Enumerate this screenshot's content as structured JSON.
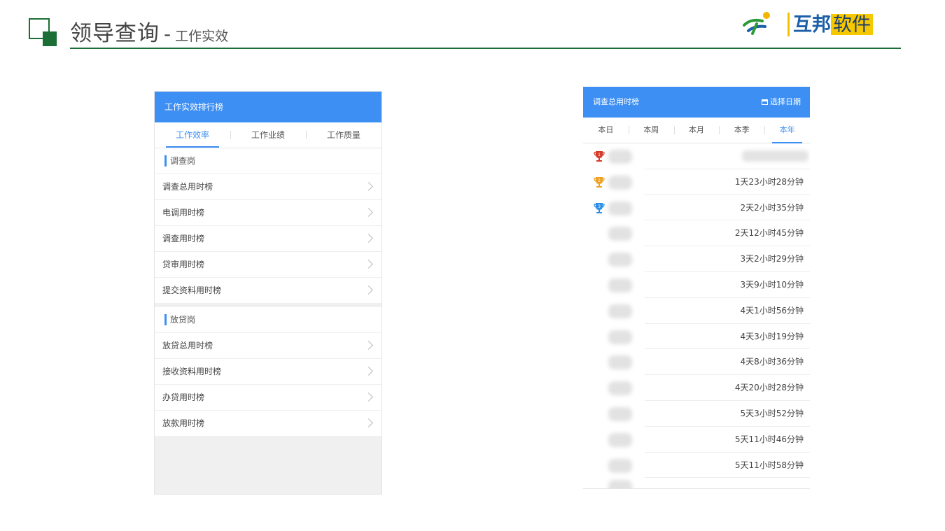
{
  "slide": {
    "title_main": "领导查询",
    "title_dash": "-",
    "title_sub": "工作实效",
    "accent_color": "#1b6e35"
  },
  "logo": {
    "icon": "running-figure-logo-icon",
    "text_part1": "互邦",
    "text_part2": "软件"
  },
  "left_panel": {
    "header_title": "工作实效排行榜",
    "tabs": [
      {
        "label": "工作效率",
        "active": true
      },
      {
        "label": "工作业绩",
        "active": false
      },
      {
        "label": "工作质量",
        "active": false
      }
    ],
    "sections": [
      {
        "title": "调查岗",
        "items": [
          "调查总用时榜",
          "电调用时榜",
          "调查用时榜",
          "贷审用时榜",
          "提交资料用时榜"
        ]
      },
      {
        "title": "放贷岗",
        "items": [
          "放贷总用时榜",
          "接收资料用时榜",
          "办贷用时榜",
          "放款用时榜"
        ]
      }
    ]
  },
  "right_panel": {
    "header_title": "调查总用时榜",
    "date_picker_label": "选择日期",
    "date_picker_icon": "calendar-icon",
    "tabs": [
      {
        "label": "本日",
        "active": false
      },
      {
        "label": "本周",
        "active": false
      },
      {
        "label": "本月",
        "active": false
      },
      {
        "label": "本季",
        "active": false
      },
      {
        "label": "本年",
        "active": true
      }
    ],
    "rows": [
      {
        "rank_icon": "trophy-gold-1-icon",
        "time": ""
      },
      {
        "rank_icon": "trophy-silver-2-icon",
        "time": "1天23小时28分钟"
      },
      {
        "rank_icon": "trophy-bronze-3-icon",
        "time": "2天2小时35分钟"
      },
      {
        "rank_icon": "",
        "time": "2天12小时45分钟"
      },
      {
        "rank_icon": "",
        "time": "3天2小时29分钟"
      },
      {
        "rank_icon": "",
        "time": "3天9小时10分钟"
      },
      {
        "rank_icon": "",
        "time": "4天1小时56分钟"
      },
      {
        "rank_icon": "",
        "time": "4天3小时19分钟"
      },
      {
        "rank_icon": "",
        "time": "4天8小时36分钟"
      },
      {
        "rank_icon": "",
        "time": "4天20小时28分钟"
      },
      {
        "rank_icon": "",
        "time": "5天3小时52分钟"
      },
      {
        "rank_icon": "",
        "time": "5天11小时46分钟"
      },
      {
        "rank_icon": "",
        "time": "5天11小时58分钟"
      }
    ],
    "trophy_colors": {
      "first": "#d63a2a",
      "second": "#f0a020",
      "third": "#2e8ee6"
    }
  }
}
